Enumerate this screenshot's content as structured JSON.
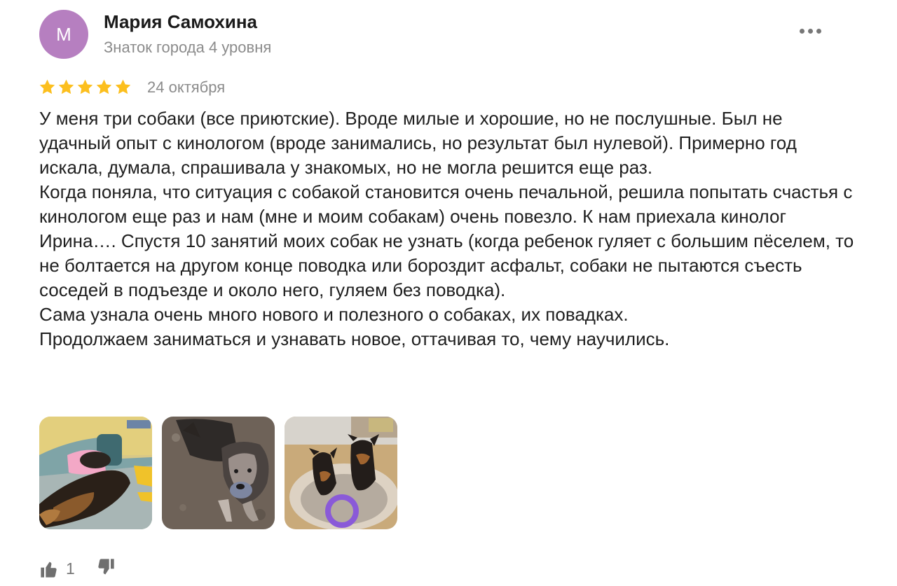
{
  "review": {
    "author": {
      "initial": "М",
      "name": "Мария Самохина",
      "level": "Знаток города 4 уровня",
      "avatar_color": "#b67fc0"
    },
    "more_icon": "more-dots-icon",
    "rating": 5,
    "rating_max": 5,
    "star_color": "#fcbf1e",
    "date": "24 октября",
    "paragraphs": [
      "У меня три собаки (все приютские). Вроде милые и хорошие, но не послушные. Был не удачный опыт с кинологом (вроде занимались, но результат был нулевой). Примерно год искала, думала, спрашивала у знакомых, но не могла решится еще раз.",
      "Когда поняла, что ситуация с собакой становится очень печальной, решила попытать счастья с кинологом еще раз и нам (мне и моим собакам) очень повезло. К нам приехала кинолог Ирина…. Спустя 10 занятий моих собак не узнать (когда ребенок гуляет с большим пёселем, то не болтается на другом конце поводка или бороздит асфальт, собаки не пытаются съесть соседей в подъезде и около него, гуляем без поводка).",
      "Сама узнала очень много нового и полезного о собаках, их повадках.",
      "Продолжаем заниматься и узнавать новое, оттачивая то, чему научились."
    ],
    "photo_count": 3,
    "likes": "1",
    "like_icon": "thumbs-up-icon",
    "dislike_icon": "thumbs-down-icon"
  }
}
